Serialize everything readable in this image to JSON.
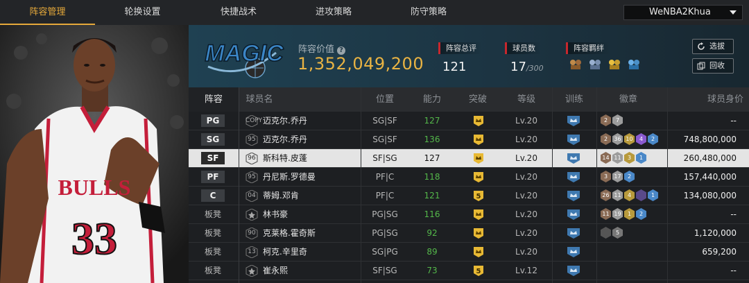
{
  "tabs": [
    {
      "label": "阵容管理",
      "active": true
    },
    {
      "label": "轮换设置",
      "active": false
    },
    {
      "label": "快捷战术",
      "active": false
    },
    {
      "label": "进攻策略",
      "active": false
    },
    {
      "label": "防守策略",
      "active": false
    }
  ],
  "user": {
    "name": "WeNBA2Khua"
  },
  "team": {
    "logo_text": "MAGIC",
    "lineup_value_label": "阵容价值",
    "lineup_value": "1,352,049,200",
    "overall_label": "阵容总评",
    "overall": "121",
    "players_label": "球员数",
    "players": "17",
    "players_max": "/300",
    "bonds_label": "阵容羁绊",
    "bonds": [
      "bond-icon-1",
      "bond-icon-2",
      "bond-icon-3",
      "bond-icon-4"
    ],
    "actions": {
      "pick": "选拔",
      "recycle": "回收"
    }
  },
  "colors": {
    "accent": "#e6a93a",
    "value": "#e9b343",
    "green": "#54b84a",
    "red": "#c8272d"
  },
  "table": {
    "headers": [
      "阵容",
      "球员名",
      "位置",
      "能力",
      "突破",
      "等级",
      "训练",
      "徽章",
      "球员身价"
    ],
    "rows": [
      {
        "lineup": "PG",
        "bench": false,
        "tag": "COPY",
        "name": "迈克尔.乔丹",
        "position": "SG|SF",
        "ability": "127",
        "green": true,
        "breakthrough": "",
        "level": "Lv.20",
        "badges": [
          {
            "v": "2",
            "c": "#8a6b55"
          },
          {
            "v": "7",
            "c": "#9c9c9c"
          }
        ],
        "value": "--",
        "selected": false
      },
      {
        "lineup": "SG",
        "bench": false,
        "tag": "95",
        "name": "迈克尔.乔丹",
        "position": "SG|SF",
        "ability": "136",
        "green": true,
        "breakthrough": "",
        "level": "Lv.20",
        "badges": [
          {
            "v": "2",
            "c": "#8a6b55"
          },
          {
            "v": "36",
            "c": "#9c9c9c"
          },
          {
            "v": "10",
            "c": "#b89a3c"
          },
          {
            "v": "4",
            "c": "#8a5ad0"
          },
          {
            "v": "2",
            "c": "#4a88c8"
          }
        ],
        "value": "748,800,000",
        "selected": false
      },
      {
        "lineup": "SF",
        "bench": false,
        "tag": "96",
        "name": "斯科特.皮蓬",
        "position": "SF|SG",
        "ability": "127",
        "green": false,
        "breakthrough": "",
        "level": "Lv.20",
        "badges": [
          {
            "v": "14",
            "c": "#8a6b55"
          },
          {
            "v": "11",
            "c": "#9c9c9c"
          },
          {
            "v": "3",
            "c": "#b89a3c"
          },
          {
            "v": "1",
            "c": "#4a88c8"
          }
        ],
        "value": "260,480,000",
        "selected": true
      },
      {
        "lineup": "PF",
        "bench": false,
        "tag": "95",
        "name": "丹尼斯.罗德曼",
        "position": "PF|C",
        "ability": "118",
        "green": true,
        "breakthrough": "",
        "level": "Lv.20",
        "badges": [
          {
            "v": "3",
            "c": "#8a6b55"
          },
          {
            "v": "17",
            "c": "#9c9c9c"
          },
          {
            "v": "2",
            "c": "#4a88c8"
          }
        ],
        "value": "157,440,000",
        "selected": false
      },
      {
        "lineup": "C",
        "bench": false,
        "tag": "04",
        "name": "蒂姆.邓肯",
        "position": "PF|C",
        "ability": "121",
        "green": true,
        "breakthrough": "5",
        "level": "Lv.20",
        "badges": [
          {
            "v": "26",
            "c": "#8a6b55"
          },
          {
            "v": "11",
            "c": "#9c9c9c"
          },
          {
            "v": "4",
            "c": "#b89a3c"
          },
          {
            "v": "",
            "c": "#5a4a8a"
          },
          {
            "v": "1",
            "c": "#4a88c8"
          }
        ],
        "value": "134,080,000",
        "selected": false
      },
      {
        "lineup": "板凳",
        "bench": true,
        "tag": "",
        "name": "林书豪",
        "position": "PG|SG",
        "ability": "116",
        "green": true,
        "breakthrough": "",
        "level": "Lv.20",
        "badges": [
          {
            "v": "11",
            "c": "#8a6b55"
          },
          {
            "v": "19",
            "c": "#9c9c9c"
          },
          {
            "v": "1",
            "c": "#b89a3c"
          },
          {
            "v": "2",
            "c": "#4a88c8"
          }
        ],
        "value": "--",
        "selected": false
      },
      {
        "lineup": "板凳",
        "bench": true,
        "tag": "90",
        "name": "克莱格.霍奇斯",
        "position": "PG|SG",
        "ability": "92",
        "green": true,
        "breakthrough": "",
        "level": "Lv.20",
        "badges": [
          {
            "v": "",
            "c": "#555"
          },
          {
            "v": "5",
            "c": "#777"
          }
        ],
        "value": "1,120,000",
        "selected": false
      },
      {
        "lineup": "板凳",
        "bench": true,
        "tag": "13",
        "name": "柯克.辛里奇",
        "position": "SG|PG",
        "ability": "89",
        "green": true,
        "breakthrough": "",
        "level": "Lv.20",
        "badges": [],
        "value": "659,200",
        "selected": false
      },
      {
        "lineup": "板凳",
        "bench": true,
        "tag": "",
        "name": "崔永熙",
        "position": "SF|SG",
        "ability": "73",
        "green": true,
        "breakthrough": "5",
        "level": "Lv.12",
        "badges": [],
        "value": "--",
        "selected": false
      }
    ]
  }
}
